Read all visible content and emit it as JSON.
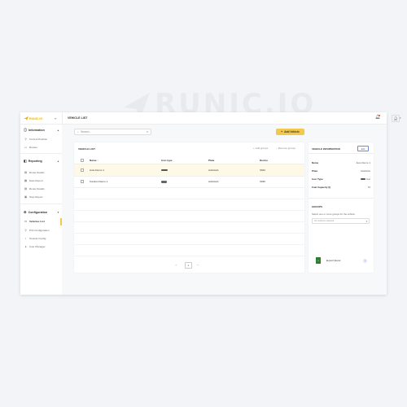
{
  "watermark": {
    "text": "RUNIC.IO"
  },
  "brand": {
    "logo_text": "RUNIC.IO",
    "accent": "#f2c94c"
  },
  "sidebar": {
    "sections": [
      {
        "label": "Information",
        "icon": "info-icon",
        "items": [
          {
            "label": "Current Position",
            "icon": "location-icon"
          },
          {
            "label": "Routes",
            "icon": "routes-icon"
          }
        ]
      },
      {
        "label": "Reporting",
        "icon": "reporting-icon",
        "items": [
          {
            "label": "Route Details",
            "icon": "route-details-icon"
          },
          {
            "label": "Date Report",
            "icon": "date-report-icon"
          },
          {
            "label": "Route Details",
            "icon": "route-details-icon"
          },
          {
            "label": "Stop Report",
            "icon": "stop-report-icon"
          }
        ]
      },
      {
        "label": "Configuration",
        "icon": "configuration-icon",
        "items": [
          {
            "label": "Vehicles List",
            "icon": "vehicles-icon",
            "active": true
          },
          {
            "label": "POI Configuration",
            "icon": "poi-icon"
          },
          {
            "label": "Sounds Config",
            "icon": "sounds-icon"
          },
          {
            "label": "User Manager",
            "icon": "user-icon"
          }
        ]
      }
    ]
  },
  "header": {
    "title": "VEHICLE LIST"
  },
  "search": {
    "placeholder": "Search..."
  },
  "toolbar": {
    "add_label": "Add Vehicle"
  },
  "table": {
    "title": "VEHICLE LIST",
    "add_group": "Add groups",
    "remove_group": "Remove groups",
    "columns": [
      "Name",
      "Icon type",
      "Plate",
      "Device"
    ],
    "rows": [
      {
        "name": "Auto Demo 1",
        "plate": "AAAAAA",
        "device": "3024",
        "selected": true
      },
      {
        "name": "Camion Demo 1",
        "plate": "AAAAAA",
        "device": "3025",
        "selected": false
      }
    ],
    "page": "1"
  },
  "panel": {
    "title": "VEHICLE INFORMATION",
    "edit_label": "Edit",
    "fields": [
      {
        "key": "Name",
        "value": "Auto Demo 1"
      },
      {
        "key": "Plate",
        "value": "AAAAAA"
      },
      {
        "key": "Icon Type",
        "value": "Car"
      },
      {
        "key": "Fuel Capacity (l)",
        "value": "70"
      }
    ],
    "groups_title": "GROUPS",
    "groups_hint": "Select one or more groups for the vehicle",
    "groups_placeholder": "No matches selected",
    "export_label": "Export Excel"
  }
}
